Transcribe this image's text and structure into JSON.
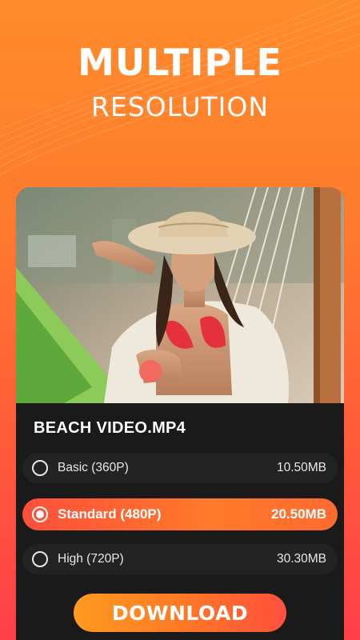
{
  "headline": {
    "title": "MULTIPLE",
    "subtitle": "RESOLUTION"
  },
  "video": {
    "filename": "BEACH VIDEO.MP4",
    "thumbnail": "woman-in-sun-hat-on-hammock-photo"
  },
  "options": [
    {
      "label": "Basic (360P)",
      "size": "10.50MB",
      "selected": false
    },
    {
      "label": "Standard (480P)",
      "size": "20.50MB",
      "selected": true
    },
    {
      "label": "High (720P)",
      "size": "30.30MB",
      "selected": false
    }
  ],
  "download_button": {
    "label": "DOWNLOAD"
  },
  "colors": {
    "background_top": "#ff8c2a",
    "background_bottom": "#ff3f4a",
    "panel": "#1a1a1a",
    "option_bg": "#232323",
    "selected_gradient_start": "#ff4f3a",
    "selected_gradient_end": "#ff7a2a"
  },
  "icons": [
    "radio-unchecked-icon",
    "radio-checked-icon"
  ]
}
